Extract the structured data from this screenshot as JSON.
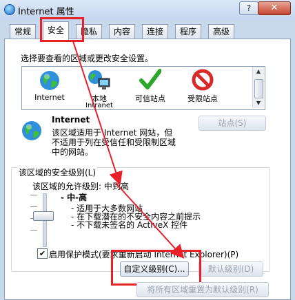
{
  "window": {
    "title": "Internet 属性",
    "help_label": "?",
    "close_label": "✕"
  },
  "tabs": [
    {
      "label": "常规"
    },
    {
      "label": "安全"
    },
    {
      "label": "隐私"
    },
    {
      "label": "内容"
    },
    {
      "label": "连接"
    },
    {
      "label": "程序"
    },
    {
      "label": "高级"
    }
  ],
  "security": {
    "prompt": "选择要查看的区域或更改安全设置。",
    "zones": [
      {
        "label": "Internet",
        "sublabel": "",
        "icon": "globe-icon"
      },
      {
        "label": "本地",
        "sublabel": "Intranet",
        "icon": "intranet-icon"
      },
      {
        "label": "可信站点",
        "sublabel": "",
        "icon": "checkmark-icon"
      },
      {
        "label": "受限站点",
        "sublabel": "",
        "icon": "restricted-icon"
      }
    ],
    "selected_zone": {
      "name": "Internet",
      "desc_lines": [
        "该区域适用于 Internet 网站，但",
        "不适用于列在受信任和受限制区域",
        "中的网站。"
      ],
      "sites_button": "站点(S)"
    },
    "level_group": {
      "title": "该区域的安全级别(L)",
      "allowed_levels": "该区域的允许级别: 中到高",
      "level_name": "- 中-高",
      "bullets": [
        "- 适用于大多数网站",
        "- 在下载潜在的不安全内容之前提示",
        "- 不下载未签名的 ActiveX 控件"
      ],
      "protected_mode": "启用保护模式(要求重新启动 Internet Explorer)(P)",
      "protected_mode_checked": true,
      "custom_level_button": "自定义级别(C)...",
      "default_level_button": "默认级别(D)"
    },
    "reset_all_button": "将所有区域重置为默认级别(R)"
  },
  "colors": {
    "highlight": "#e8202a"
  }
}
